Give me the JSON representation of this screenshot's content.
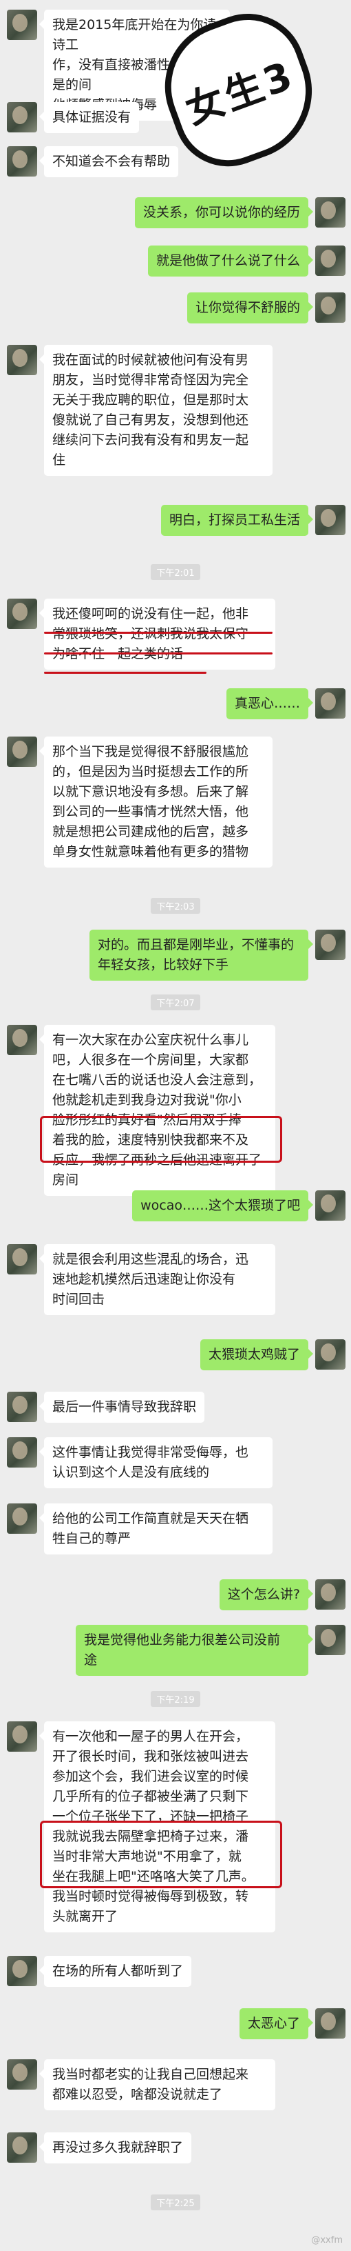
{
  "badge_text": "女生3",
  "watermark": "@xxfm",
  "colors": {
    "background": "#ededed",
    "incoming_bubble": "#ffffff",
    "outgoing_bubble": "#9eea6a",
    "highlight": "#c8101a"
  },
  "messages": [
    {
      "side": "left",
      "lines": [
        "我是2015年底开始在为你读诗工",
        "作，没有直接被潘性侵，但是的间",
        "他频繁感到被侮辱"
      ]
    },
    {
      "side": "left",
      "lines": [
        "具体证据没有"
      ]
    },
    {
      "side": "left",
      "lines": [
        "不知道会不会有帮助"
      ]
    },
    {
      "side": "right",
      "lines": [
        "没关系，你可以说你的经历"
      ]
    },
    {
      "side": "right",
      "lines": [
        "就是他做了什么说了什么"
      ]
    },
    {
      "side": "right",
      "lines": [
        "让你觉得不舒服的"
      ]
    },
    {
      "side": "left",
      "lines": [
        "我在面试的时候就被他问有没有男",
        "朋友，当时觉得非常奇怪因为完全",
        "无关于我应聘的职位，但是那时太",
        "傻就说了自己有男友，没想到他还",
        "继续问下去问我有没有和男友一起",
        "住"
      ]
    },
    {
      "side": "right",
      "lines": [
        "明白，打探员工私生活"
      ]
    },
    {
      "time": "下午2:01"
    },
    {
      "side": "left",
      "lines": [
        "我还傻呵呵的说没有住一起，他非",
        "常猥琐地笑，还讽刺我说我太保守",
        "为啥不住一起之类的话"
      ]
    },
    {
      "side": "right",
      "lines": [
        "真恶心……"
      ]
    },
    {
      "side": "left",
      "lines": [
        "那个当下我是觉得很不舒服很尴尬",
        "的，但是因为当时挺想去工作的所",
        "以就下意识地没有多想。后来了解",
        "到公司的一些事情才恍然大悟，他",
        "就是想把公司建成他的后宫，越多",
        "单身女性就意味着他有更多的猎物"
      ]
    },
    {
      "time": "下午2:03"
    },
    {
      "side": "right",
      "lines": [
        "对的。而且都是刚毕业，不懂事的",
        "年轻女孩，比较好下手"
      ]
    },
    {
      "time": "下午2:07"
    },
    {
      "side": "left",
      "lines": [
        "有一次大家在办公室庆祝什么事儿",
        "吧，人很多在一个房间里，大家都",
        "在七嘴八舌的说话也没人会注意到，",
        "他就趁机走到我身边对我说\"你小",
        "脸形彤红的真好看\"然后用双手捧",
        "着我的脸，速度特别快我都来不及",
        "反应，我愣了两秒之后他迅速离开了房间"
      ]
    },
    {
      "side": "right",
      "lines": [
        "wocao……这个太猥琐了吧"
      ]
    },
    {
      "side": "left",
      "lines": [
        "就是很会利用这些混乱的场合，迅",
        "速地趁机摸然后迅速跑让你没有",
        "时间回击"
      ]
    },
    {
      "side": "right",
      "lines": [
        "太猥琐太鸡贼了"
      ]
    },
    {
      "side": "left",
      "lines": [
        "最后一件事情导致我辞职"
      ]
    },
    {
      "side": "left",
      "lines": [
        "这件事情让我觉得非常受侮辱，也",
        "认识到这个人是没有底线的"
      ]
    },
    {
      "side": "left",
      "lines": [
        "给他的公司工作简直就是天天在牺",
        "牲自己的尊严"
      ]
    },
    {
      "side": "right",
      "lines": [
        "这个怎么讲?"
      ]
    },
    {
      "side": "right",
      "lines": [
        "我是觉得他业务能力很差公司没前",
        "途"
      ]
    },
    {
      "time": "下午2:19"
    },
    {
      "side": "left",
      "lines": [
        "有一次他和一屋子的男人在开会，",
        "开了很长时间，我和张炫被叫进去",
        "参加这个会，我们进会议室的时候",
        "几乎所有的位子都被坐满了只剩下",
        "一个位子张坐下了，还缺一把椅子",
        "我就说我去隔壁拿把椅子过来，潘",
        "当时非常大声地说\"不用拿了，就",
        "坐在我腿上吧\"还咯咯大笑了几声。",
        "我当时顿时觉得被侮辱到极致，转",
        "头就离开了"
      ]
    },
    {
      "side": "left",
      "lines": [
        "在场的所有人都听到了"
      ]
    },
    {
      "side": "right",
      "lines": [
        "太恶心了"
      ]
    },
    {
      "side": "left",
      "lines": [
        "我当时都老实的让我自己回想起来",
        "都难以忍受，啥都没说就走了"
      ]
    },
    {
      "side": "left",
      "lines": [
        "再没过多久我就辞职了"
      ]
    },
    {
      "time": "下午2:25"
    }
  ]
}
